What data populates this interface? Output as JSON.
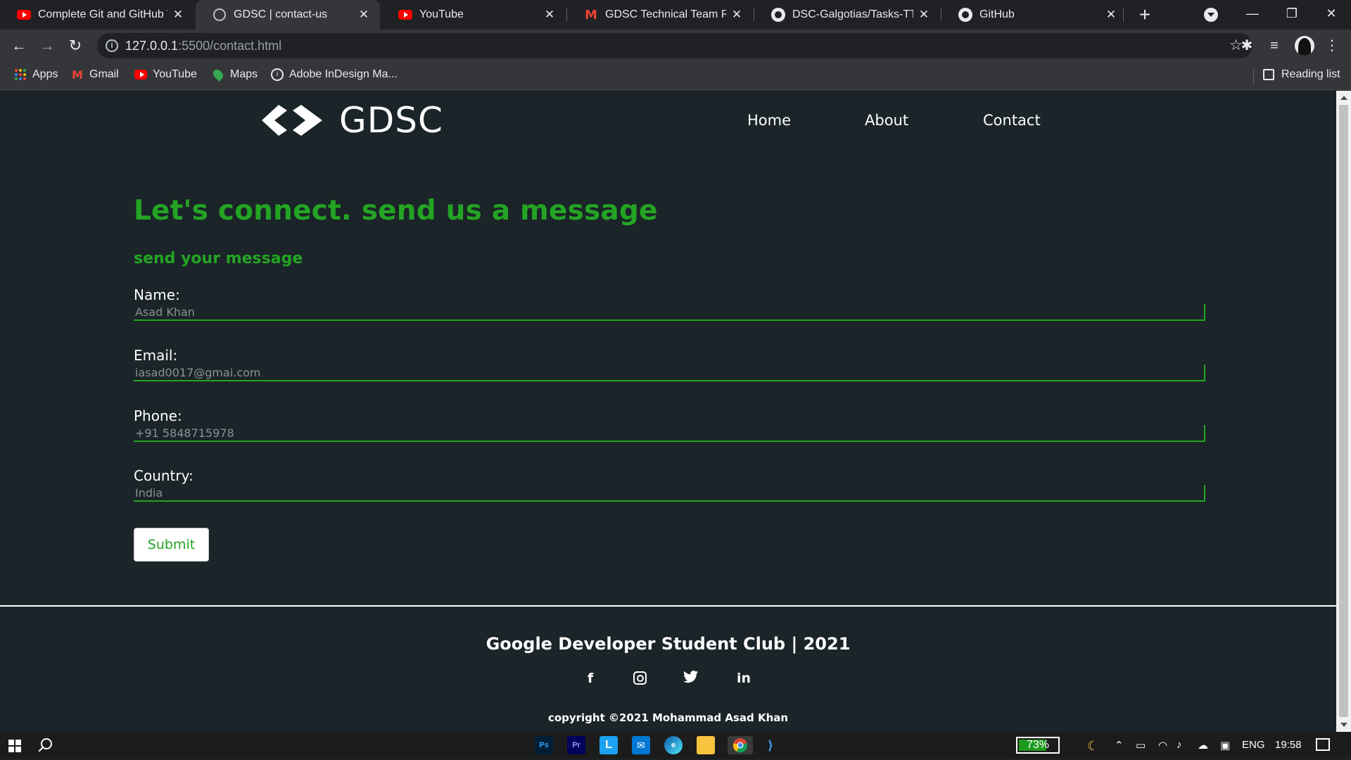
{
  "browser": {
    "tabs": [
      {
        "title": "Complete Git and GitHub Tu",
        "favicon": "youtube-icon",
        "active": false
      },
      {
        "title": "GDSC | contact-us",
        "favicon": "globe-icon",
        "active": true
      },
      {
        "title": "YouTube",
        "favicon": "youtube-icon",
        "active": false
      },
      {
        "title": "GDSC Technical Team Round",
        "favicon": "gmail-icon",
        "active": false
      },
      {
        "title": "DSC-Galgotias/Tasks-TT_GD",
        "favicon": "github-icon",
        "active": false
      },
      {
        "title": "GitHub",
        "favicon": "github-icon",
        "active": false
      }
    ],
    "url_host": "127.0.0.1",
    "url_path": ":5500/contact.html",
    "bookmarks": [
      {
        "label": "Apps",
        "icon": "apps-grid-icon"
      },
      {
        "label": "Gmail",
        "icon": "gmail-icon"
      },
      {
        "label": "YouTube",
        "icon": "youtube-icon"
      },
      {
        "label": "Maps",
        "icon": "maps-icon"
      },
      {
        "label": "Adobe InDesign Ma...",
        "icon": "indesign-icon"
      }
    ],
    "reading_list": "Reading list"
  },
  "site": {
    "logo_text": "GDSC",
    "nav": {
      "home": "Home",
      "about": "About",
      "contact": "Contact"
    },
    "heading": "Let's connect. send us a message",
    "subheading": "send your message",
    "form": {
      "name_label": "Name:",
      "name_value": "Asad Khan",
      "email_label": "Email:",
      "email_value": "iasad0017@gmai.com",
      "phone_label": "Phone:",
      "phone_value": "+91 5848715978",
      "country_label": "Country:",
      "country_value": "India",
      "submit_label": "Submit"
    },
    "footer": {
      "title": "Google Developer Student Club | 2021",
      "social": [
        "facebook-icon",
        "instagram-icon",
        "twitter-icon",
        "linkedin-icon"
      ],
      "copyright": "copyright ©2021 Mohammad Asad Khan"
    }
  },
  "taskbar": {
    "apps": [
      "photoshop-icon",
      "premiere-icon",
      "l-app-icon",
      "mail-icon",
      "edge-icon",
      "file-explorer-icon",
      "chrome-icon",
      "vscode-icon"
    ],
    "battery": "73%",
    "battery_level": 0.73,
    "language": "ENG",
    "time": "19:58"
  },
  "colors": {
    "accent_green": "#23a423",
    "page_bg": "#1b2428",
    "chrome_dark": "#202124",
    "chrome_toolbar": "#35363a"
  }
}
